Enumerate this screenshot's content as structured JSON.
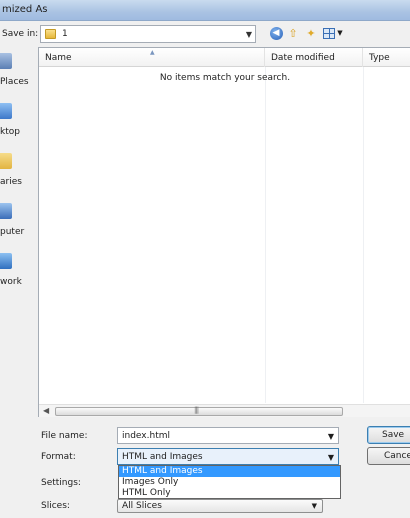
{
  "window": {
    "title": "mized As"
  },
  "toolbar": {
    "save_in_label": "Save in:",
    "save_in_value": "1"
  },
  "places": [
    {
      "label": "Places",
      "icon": "recent-places-icon",
      "color": "#5b7fb4"
    },
    {
      "label": "ktop",
      "icon": "desktop-icon",
      "color": "#3d78c9"
    },
    {
      "label": "aries",
      "icon": "libraries-icon",
      "color": "#e2b441"
    },
    {
      "label": "puter",
      "icon": "computer-icon",
      "color": "#3a6db8"
    },
    {
      "label": "work",
      "icon": "network-icon",
      "color": "#2f6fbf"
    }
  ],
  "file_list": {
    "columns": [
      "Name",
      "Date modified",
      "Type"
    ],
    "empty_message": "No items match your search."
  },
  "fields": {
    "file_name_label": "File name:",
    "file_name_value": "index.html",
    "format_label": "Format:",
    "format_value": "HTML and Images",
    "format_options": [
      "HTML and Images",
      "Images Only",
      "HTML Only"
    ],
    "settings_label": "Settings:",
    "slices_label": "Slices:",
    "slices_value": "All Slices"
  },
  "buttons": {
    "save": "Save",
    "cancel": "Cancel"
  }
}
